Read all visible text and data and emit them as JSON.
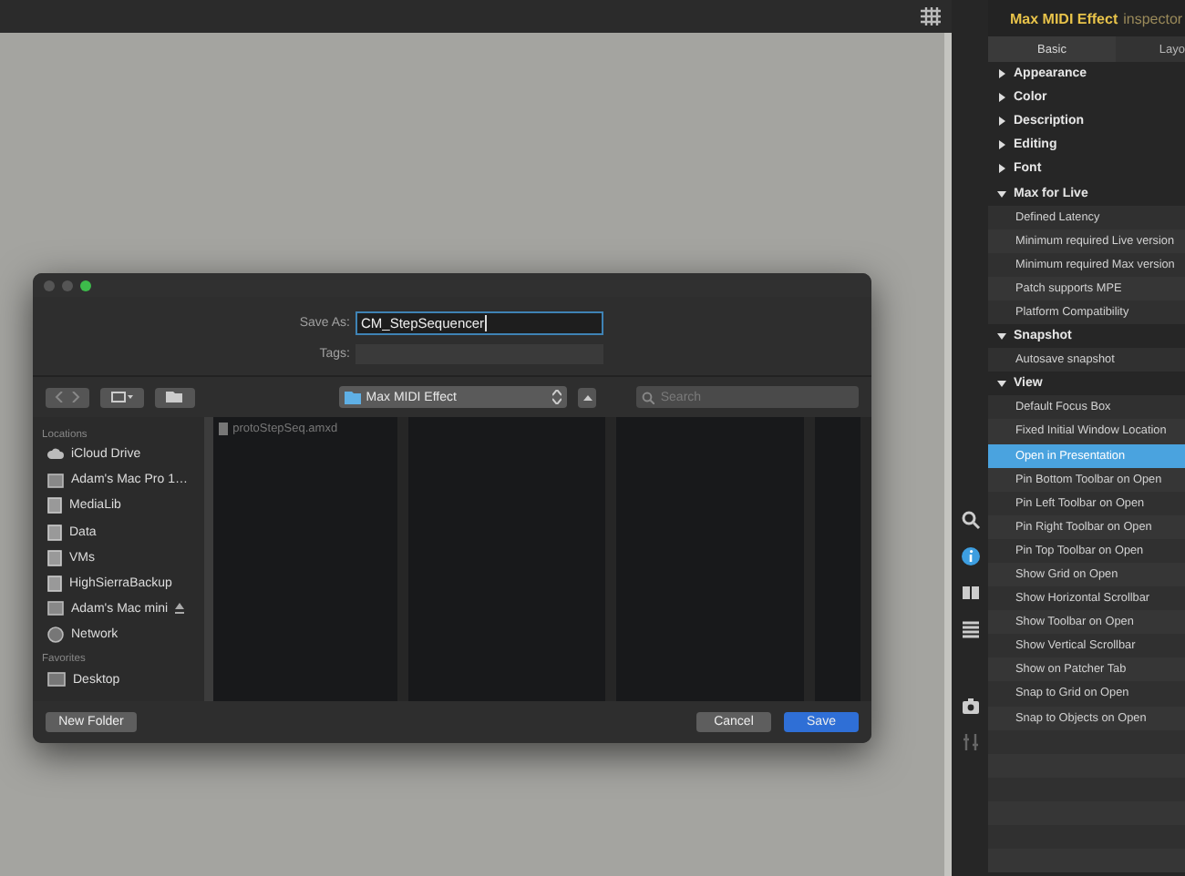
{
  "dialog": {
    "save_as_label": "Save As:",
    "save_as_value": "CM_StepSequencer",
    "tags_label": "Tags:",
    "location": "Max MIDI Effect",
    "search": {
      "placeholder": "Search"
    },
    "sidebar": [
      {
        "kind": "heading",
        "label": "Locations"
      },
      {
        "kind": "cloud",
        "label": "iCloud Drive",
        "ejectable": false
      },
      {
        "kind": "computer",
        "label": "Adam's Mac Pro 1…",
        "ejectable": false
      },
      {
        "kind": "drive",
        "label": "MediaLib",
        "ejectable": false
      },
      {
        "kind": "drive",
        "label": "Data",
        "ejectable": false
      },
      {
        "kind": "drive",
        "label": "VMs",
        "ejectable": false
      },
      {
        "kind": "drive",
        "label": "HighSierraBackup",
        "ejectable": false
      },
      {
        "kind": "computer",
        "label": "Adam's Mac mini",
        "ejectable": true
      },
      {
        "kind": "network",
        "label": "Network",
        "ejectable": false
      },
      {
        "kind": "heading",
        "label": "Favorites"
      },
      {
        "kind": "desktop",
        "label": "Desktop",
        "ejectable": false
      }
    ],
    "files": [
      {
        "name": "protoStepSeq.amxd",
        "disabled": true
      }
    ],
    "new_folder": "New Folder",
    "cancel": "Cancel",
    "save": "Save"
  },
  "side_toolbar": [
    {
      "kind": "search",
      "selected": false
    },
    {
      "kind": "info",
      "selected": true
    },
    {
      "kind": "split",
      "selected": false
    },
    {
      "kind": "list",
      "selected": false
    },
    {
      "kind": "camera",
      "selected": false
    },
    {
      "kind": "mixer",
      "selected": false
    }
  ],
  "inspector": {
    "title": "Max MIDI Effect",
    "subtitle": "inspector",
    "tabs": [
      {
        "label": "Basic",
        "selected": true
      },
      {
        "label": "Layo",
        "selected": false
      }
    ],
    "tree": [
      {
        "label": "Appearance",
        "expanded": false
      },
      {
        "label": "Color",
        "expanded": false
      },
      {
        "label": "Description",
        "expanded": false
      },
      {
        "label": "Editing",
        "expanded": false
      },
      {
        "label": "Font",
        "expanded": false
      },
      {
        "label": "Max for Live",
        "expanded": true,
        "children": [
          {
            "label": "Defined Latency",
            "selected": false
          },
          {
            "label": "Minimum required Live version",
            "selected": false
          },
          {
            "label": "Minimum required Max version",
            "selected": false
          },
          {
            "label": "Patch supports MPE",
            "selected": false
          },
          {
            "label": "Platform Compatibility",
            "selected": false
          }
        ]
      },
      {
        "label": "Snapshot",
        "expanded": true,
        "children": [
          {
            "label": "Autosave snapshot",
            "selected": false
          }
        ]
      },
      {
        "label": "View",
        "expanded": true,
        "children": [
          {
            "label": "Default Focus Box",
            "selected": false
          },
          {
            "label": "Fixed Initial Window Location",
            "selected": false
          },
          {
            "label": "Open in Presentation",
            "selected": true
          },
          {
            "label": "Pin Bottom Toolbar on Open",
            "selected": false
          },
          {
            "label": "Pin Left Toolbar on Open",
            "selected": false
          },
          {
            "label": "Pin Right Toolbar on Open",
            "selected": false
          },
          {
            "label": "Pin Top Toolbar on Open",
            "selected": false
          },
          {
            "label": "Show Grid on Open",
            "selected": false
          },
          {
            "label": "Show Horizontal Scrollbar",
            "selected": false
          },
          {
            "label": "Show Toolbar on Open",
            "selected": false
          },
          {
            "label": "Show Vertical Scrollbar",
            "selected": false
          },
          {
            "label": "Show on Patcher Tab",
            "selected": false
          },
          {
            "label": "Snap to Grid on Open",
            "selected": false
          },
          {
            "label": "Snap to Objects on Open",
            "selected": false
          }
        ]
      }
    ]
  }
}
